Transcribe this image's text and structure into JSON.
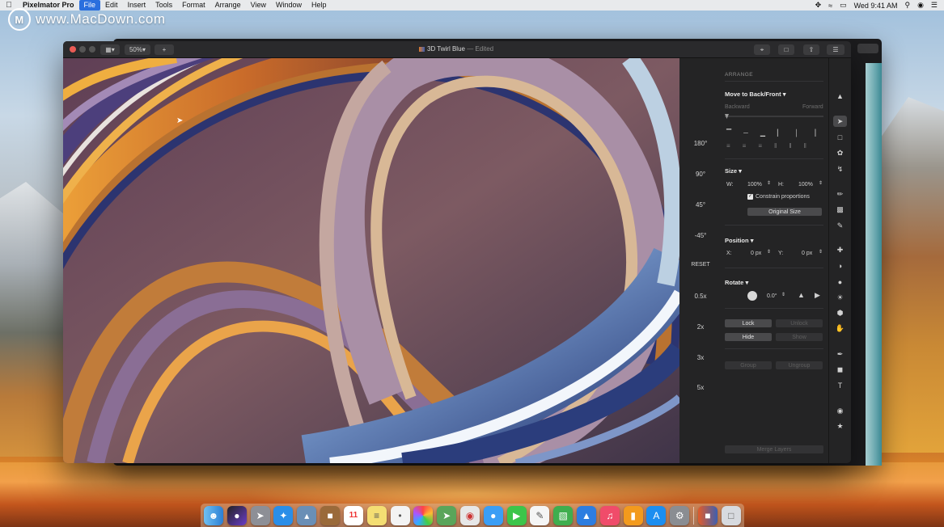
{
  "menubar": {
    "app_name": "Pixelmator Pro",
    "items": [
      "File",
      "Edit",
      "Insert",
      "Tools",
      "Format",
      "Arrange",
      "View",
      "Window",
      "Help"
    ],
    "active_item": "File",
    "clock": "Wed 9:41 AM"
  },
  "watermark": {
    "text": "www.MacDown.com"
  },
  "window": {
    "title": "3D Twirl Blue",
    "edited": " — Edited",
    "zoom": "50%"
  },
  "rotate_panel": [
    "180°",
    "90°",
    "45°",
    "-45°",
    "RESET",
    "0.5x",
    "2x",
    "3x",
    "5x"
  ],
  "inspector": {
    "section": "ARRANGE",
    "move_label": "Move to Back/Front",
    "backward": "Backward",
    "forward": "Forward",
    "size_label": "Size",
    "w_label": "W:",
    "w_value": "100%",
    "h_label": "H:",
    "h_value": "100%",
    "constrain_label": "Constrain proportions",
    "constrain_checked": true,
    "original_size_label": "Original Size",
    "position_label": "Position",
    "x_label": "X:",
    "x_value": "0 px",
    "y_label": "Y:",
    "y_value": "0 px",
    "rotate_label": "Rotate",
    "rotate_value": "0.0°",
    "lock_label": "Lock",
    "unlock_label": "Unlock",
    "hide_label": "Hide",
    "show_label": "Show",
    "group_label": "Group",
    "ungroup_label": "Ungroup",
    "merge_label": "Merge Layers"
  },
  "calendar_date": "11",
  "colors": {
    "accent": "#2a6fde",
    "window_bg": "#242425"
  }
}
